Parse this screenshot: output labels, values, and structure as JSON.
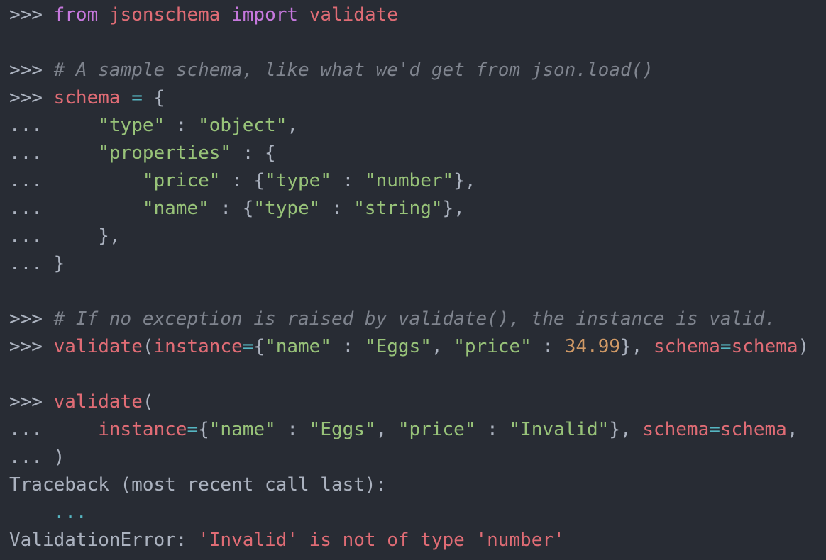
{
  "lines": [
    {
      "type": "code",
      "tokens": [
        {
          "cls": "prompt",
          "text": ">>> "
        },
        {
          "cls": "kw",
          "text": "from"
        },
        {
          "cls": "punc",
          "text": " "
        },
        {
          "cls": "name",
          "text": "jsonschema"
        },
        {
          "cls": "punc",
          "text": " "
        },
        {
          "cls": "kw",
          "text": "import"
        },
        {
          "cls": "punc",
          "text": " "
        },
        {
          "cls": "name",
          "text": "validate"
        }
      ]
    },
    {
      "type": "blank",
      "tokens": []
    },
    {
      "type": "code",
      "tokens": [
        {
          "cls": "prompt",
          "text": ">>> "
        },
        {
          "cls": "cm",
          "text": "# A sample schema, like what we'd get from json.load()"
        }
      ]
    },
    {
      "type": "code",
      "tokens": [
        {
          "cls": "prompt",
          "text": ">>> "
        },
        {
          "cls": "name",
          "text": "schema"
        },
        {
          "cls": "punc",
          "text": " "
        },
        {
          "cls": "op",
          "text": "="
        },
        {
          "cls": "punc",
          "text": " {"
        }
      ]
    },
    {
      "type": "code",
      "tokens": [
        {
          "cls": "prompt",
          "text": "...     "
        },
        {
          "cls": "str",
          "text": "\"type\""
        },
        {
          "cls": "punc",
          "text": " : "
        },
        {
          "cls": "str",
          "text": "\"object\""
        },
        {
          "cls": "punc",
          "text": ","
        }
      ]
    },
    {
      "type": "code",
      "tokens": [
        {
          "cls": "prompt",
          "text": "...     "
        },
        {
          "cls": "str",
          "text": "\"properties\""
        },
        {
          "cls": "punc",
          "text": " : {"
        }
      ]
    },
    {
      "type": "code",
      "tokens": [
        {
          "cls": "prompt",
          "text": "...         "
        },
        {
          "cls": "str",
          "text": "\"price\""
        },
        {
          "cls": "punc",
          "text": " : {"
        },
        {
          "cls": "str",
          "text": "\"type\""
        },
        {
          "cls": "punc",
          "text": " : "
        },
        {
          "cls": "str",
          "text": "\"number\""
        },
        {
          "cls": "punc",
          "text": "},"
        }
      ]
    },
    {
      "type": "code",
      "tokens": [
        {
          "cls": "prompt",
          "text": "...         "
        },
        {
          "cls": "str",
          "text": "\"name\""
        },
        {
          "cls": "punc",
          "text": " : {"
        },
        {
          "cls": "str",
          "text": "\"type\""
        },
        {
          "cls": "punc",
          "text": " : "
        },
        {
          "cls": "str",
          "text": "\"string\""
        },
        {
          "cls": "punc",
          "text": "},"
        }
      ]
    },
    {
      "type": "code",
      "tokens": [
        {
          "cls": "prompt",
          "text": "...     "
        },
        {
          "cls": "punc",
          "text": "},"
        }
      ]
    },
    {
      "type": "code",
      "tokens": [
        {
          "cls": "prompt",
          "text": "... "
        },
        {
          "cls": "punc",
          "text": "}"
        }
      ]
    },
    {
      "type": "blank",
      "tokens": []
    },
    {
      "type": "code",
      "tokens": [
        {
          "cls": "prompt",
          "text": ">>> "
        },
        {
          "cls": "cm",
          "text": "# If no exception is raised by validate(), the instance is valid."
        }
      ]
    },
    {
      "type": "code",
      "tokens": [
        {
          "cls": "prompt",
          "text": ">>> "
        },
        {
          "cls": "name",
          "text": "validate"
        },
        {
          "cls": "punc",
          "text": "("
        },
        {
          "cls": "name",
          "text": "instance"
        },
        {
          "cls": "op",
          "text": "="
        },
        {
          "cls": "punc",
          "text": "{"
        },
        {
          "cls": "str",
          "text": "\"name\""
        },
        {
          "cls": "punc",
          "text": " : "
        },
        {
          "cls": "str",
          "text": "\"Eggs\""
        },
        {
          "cls": "punc",
          "text": ", "
        },
        {
          "cls": "str",
          "text": "\"price\""
        },
        {
          "cls": "punc",
          "text": " : "
        },
        {
          "cls": "num",
          "text": "34.99"
        },
        {
          "cls": "punc",
          "text": "}, "
        },
        {
          "cls": "name",
          "text": "schema"
        },
        {
          "cls": "op",
          "text": "="
        },
        {
          "cls": "name",
          "text": "schema"
        },
        {
          "cls": "punc",
          "text": ")"
        }
      ]
    },
    {
      "type": "blank",
      "tokens": []
    },
    {
      "type": "code",
      "tokens": [
        {
          "cls": "prompt",
          "text": ">>> "
        },
        {
          "cls": "name",
          "text": "validate"
        },
        {
          "cls": "punc",
          "text": "("
        }
      ]
    },
    {
      "type": "code",
      "tokens": [
        {
          "cls": "prompt",
          "text": "...     "
        },
        {
          "cls": "name",
          "text": "instance"
        },
        {
          "cls": "op",
          "text": "="
        },
        {
          "cls": "punc",
          "text": "{"
        },
        {
          "cls": "str",
          "text": "\"name\""
        },
        {
          "cls": "punc",
          "text": " : "
        },
        {
          "cls": "str",
          "text": "\"Eggs\""
        },
        {
          "cls": "punc",
          "text": ", "
        },
        {
          "cls": "str",
          "text": "\"price\""
        },
        {
          "cls": "punc",
          "text": " : "
        },
        {
          "cls": "str",
          "text": "\"Invalid\""
        },
        {
          "cls": "punc",
          "text": "}, "
        },
        {
          "cls": "name",
          "text": "schema"
        },
        {
          "cls": "op",
          "text": "="
        },
        {
          "cls": "name",
          "text": "schema"
        },
        {
          "cls": "punc",
          "text": ","
        }
      ]
    },
    {
      "type": "code",
      "tokens": [
        {
          "cls": "prompt",
          "text": "... "
        },
        {
          "cls": "punc",
          "text": ")"
        }
      ]
    },
    {
      "type": "output",
      "tokens": [
        {
          "cls": "plain",
          "text": "Traceback (most recent call last):"
        }
      ]
    },
    {
      "type": "output",
      "tokens": [
        {
          "cls": "plain",
          "text": "    "
        },
        {
          "cls": "op",
          "text": "..."
        }
      ]
    },
    {
      "type": "output",
      "tokens": [
        {
          "cls": "plain",
          "text": "ValidationError: "
        },
        {
          "cls": "err",
          "text": "'Invalid' is not of type 'number'"
        }
      ]
    }
  ]
}
